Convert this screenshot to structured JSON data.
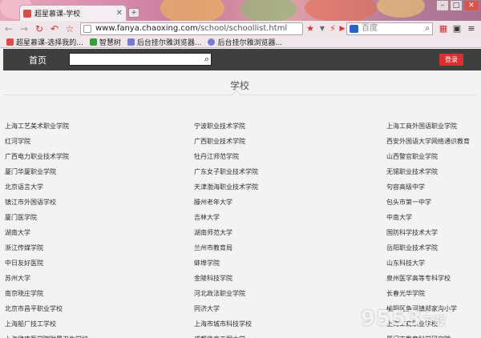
{
  "browser": {
    "tab_title": "超星慕课-学校",
    "url_host": "www.fanya.chaoxing.com",
    "url_path": "/school/schoollist.html",
    "search_placeholder": "百度",
    "bookmarks": [
      {
        "label": "超星慕课-选择我的...",
        "color": "#d84c4c"
      },
      {
        "label": "智慧树",
        "color": "#3a9b3a"
      },
      {
        "label": "后台挂尔雅浏览器...",
        "color": "#7a7ad8"
      },
      {
        "label": "后台挂尔雅浏览器...",
        "color": "#7a7ad8"
      }
    ]
  },
  "site": {
    "home_label": "首页",
    "login_label": "登录",
    "page_title": "学校"
  },
  "schools": [
    [
      "上海工艺美术职业学院",
      "宁波职业技术学院",
      "上海工商外国语职业学院"
    ],
    [
      "红河学院",
      "广西职业技术学院",
      "西安外国语大学网络通识教育"
    ],
    [
      "广西电力职业技术学院",
      "牡丹江师范学院",
      "山西警官职业学院"
    ],
    [
      "厦门华厦职业学院",
      "广东女子职业技术学院",
      "无锡职业技术学院"
    ],
    [
      "北京语言大学",
      "天津渤海职业技术学院",
      "句容高级中学"
    ],
    [
      "镇江市外国语学校",
      "滕州老年大学",
      "包头市第一中学"
    ],
    [
      "厦门医学院",
      "吉林大学",
      "中南大学"
    ],
    [
      "湖南大学",
      "湖南师范大学",
      "国防科学技术大学"
    ],
    [
      "浙江传媒学院",
      "兰州市教育局",
      "岳阳职业技术学院"
    ],
    [
      "中日友好医院",
      "蚌埠学院",
      "山东科技大学"
    ],
    [
      "苏州大学",
      "金陵科技学院",
      "泉州医学高等专科学校"
    ],
    [
      "南京晓庄学院",
      "河北政法职业学院",
      "长春光华学院"
    ],
    [
      "北京市昌平职业学校",
      "同济大学",
      "榆阳区鱼河镇郑家沟小学"
    ],
    [
      "上海船厂技工学校",
      "上海市城市科技学校",
      "上海工商职业学校"
    ],
    [
      "上海健康医学院附属卫生学校",
      "成都信息工程大学",
      "厦门市教育科学研究院"
    ]
  ],
  "watermark": "9553下载"
}
